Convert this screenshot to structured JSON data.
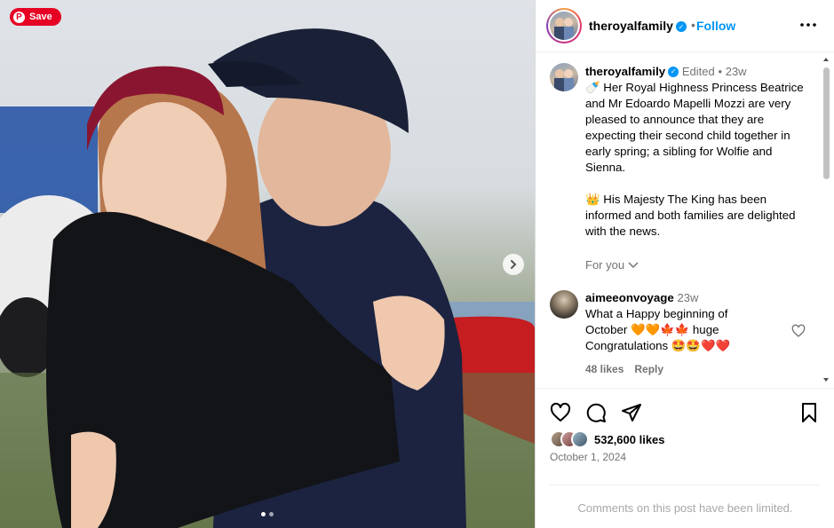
{
  "photo": {
    "save_label": "Save",
    "pinterest_icon": "pinterest-icon",
    "next_icon": "chevron-right-icon",
    "carousel": {
      "count": 2,
      "active": 1
    }
  },
  "header": {
    "username": "theroyalfamily",
    "dot": "•",
    "follow_label": "Follow",
    "more_icon": "more-horizontal-icon"
  },
  "caption": {
    "username": "theroyalfamily",
    "edited": "Edited",
    "dot": "•",
    "time": "23w",
    "emoji_1": "🍼",
    "text_1": "Her Royal Highness Princess Beatrice and Mr Edoardo Mapelli Mozzi are very pleased to announce that they are expecting their second child together in early spring; a sibling for Wolfie and Sienna.",
    "emoji_2": "👑",
    "text_2": "His Majesty The King has been informed and both families are delighted with the news.",
    "for_you": "For you"
  },
  "comment": {
    "username": "aimeeonvoyage",
    "time": "23w",
    "text_1": "What a Happy beginning of",
    "text_2": "October 🧡🧡🍁🍁 huge",
    "text_3": "Congratulations 🤩🤩❤️❤️",
    "likes": "48 likes",
    "reply": "Reply"
  },
  "actions": {
    "like_icon": "heart-icon",
    "comment_icon": "comment-icon",
    "share_icon": "share-icon",
    "save_icon": "bookmark-icon"
  },
  "likes": {
    "count_text": "532,600 likes"
  },
  "date": "October 1, 2024",
  "comments_limited": "Comments on this post have been limited.",
  "colors": {
    "accent": "#0095f6",
    "pinterest": "#e60023",
    "muted": "#737373"
  }
}
